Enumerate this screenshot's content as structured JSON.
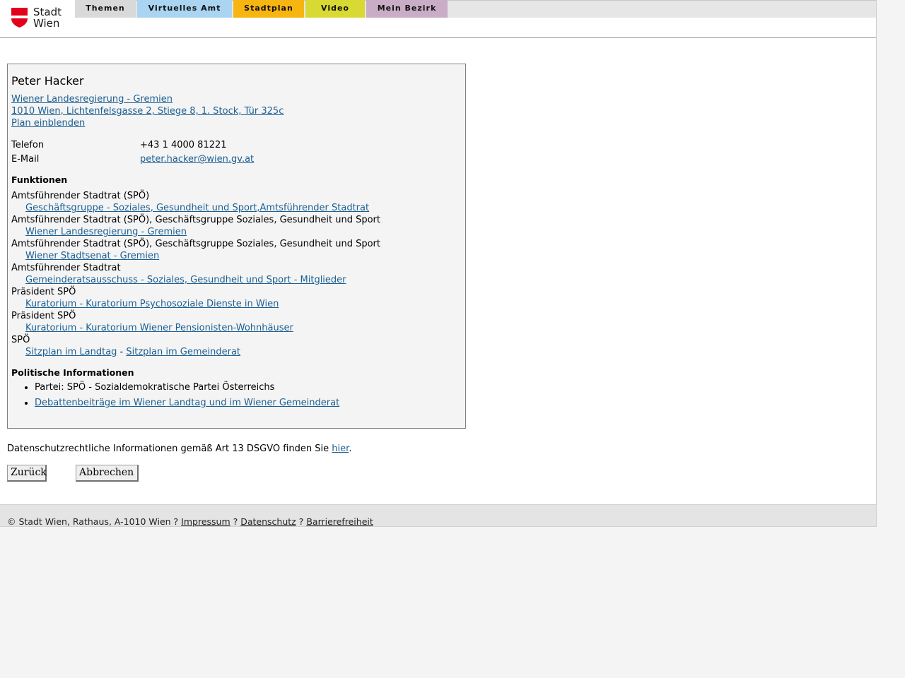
{
  "logo": {
    "line1": "Stadt",
    "line2": "Wien"
  },
  "nav": {
    "tabs": [
      {
        "label": "Themen",
        "color": "#d9d9d9"
      },
      {
        "label": "Virtuelles Amt",
        "color": "#a9d5f2"
      },
      {
        "label": "Stadtplan",
        "color": "#f7b512"
      },
      {
        "label": "Video",
        "color": "#d9d934"
      },
      {
        "label": "Mein Bezirk",
        "color": "#c9adc6"
      }
    ]
  },
  "person": {
    "name": "Peter Hacker",
    "org_link": "Wiener Landesregierung - Gremien ",
    "address_link": "1010 Wien, Lichtenfelsgasse 2, Stiege 8, 1. Stock, Tür 325c",
    "plan_link": "Plan einblenden",
    "phone_label": "Telefon",
    "phone_value": "+43 1 4000 81221",
    "email_label": "E-Mail",
    "email_value": "peter.hacker@wien.gv.at"
  },
  "functions": {
    "heading": "Funktionen",
    "items": [
      {
        "role": "Amtsführender Stadtrat (SPÖ)",
        "link": "Geschäftsgruppe - Soziales, Gesundheit und Sport,Amtsführender Stadtrat"
      },
      {
        "role": "Amtsführender Stadtrat (SPÖ), Geschäftsgruppe Soziales, Gesundheit und Sport",
        "link": "Wiener Landesregierung - Gremien"
      },
      {
        "role": "Amtsführender Stadtrat (SPÖ), Geschäftsgruppe Soziales, Gesundheit und Sport",
        "link": "Wiener Stadtsenat - Gremien"
      },
      {
        "role": "Amtsführender Stadtrat",
        "link": "Gemeinderatsausschuss - Soziales, Gesundheit und Sport - Mitglieder"
      },
      {
        "role": "Präsident SPÖ",
        "link": "Kuratorium - Kuratorium Psychosoziale Dienste in Wien"
      },
      {
        "role": "Präsident SPÖ",
        "link": "Kuratorium - Kuratorium Wiener Pensionisten-Wohnhäuser"
      }
    ],
    "party_role": "SPÖ",
    "seat_link_1": "Sitzplan im Landtag",
    "seat_separator": " - ",
    "seat_link_2": "Sitzplan im Gemeinderat"
  },
  "political": {
    "heading": "Politische Informationen",
    "party": "Partei: SPÖ - Sozialdemokratische Partei Österreichs",
    "debate_link": "Debattenbeiträge im Wiener Landtag und im Wiener Gemeinderat"
  },
  "privacy": {
    "text": "Datenschutzrechtliche Informationen gemäß Art 13 DSGVO finden Sie ",
    "link": "hier",
    "end": "."
  },
  "buttons": {
    "back": "Zurück",
    "cancel": "Abbrechen"
  },
  "footer": {
    "copyright": "© Stadt Wien, Rathaus, A-1010 Wien ? ",
    "impressum": "Impressum",
    "sep": " ? ",
    "datenschutz": "Datenschutz",
    "barrierefreiheit": "Barrierefreiheit"
  }
}
